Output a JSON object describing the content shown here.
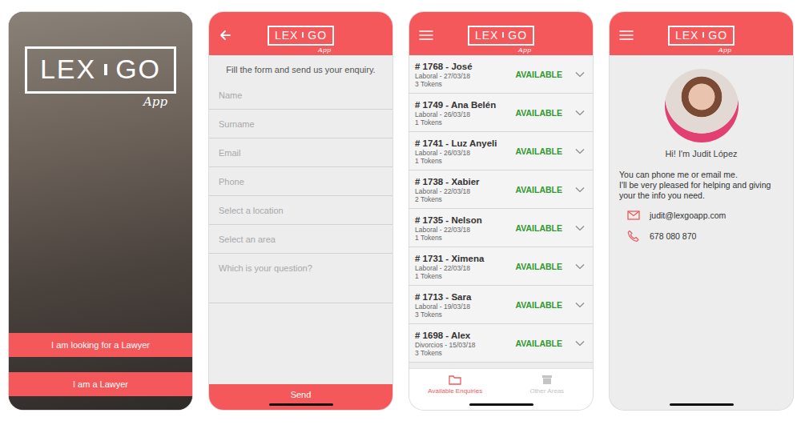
{
  "logo": {
    "left": "LEX",
    "right": "GO",
    "script": "App"
  },
  "welcome": {
    "buttons": [
      {
        "label": "I am looking for a Lawyer"
      },
      {
        "label": "I am a Lawyer"
      }
    ]
  },
  "enquiry_form": {
    "intro": "Fill the form and send us your enquiry.",
    "fields": [
      {
        "placeholder": "Name",
        "kind": "input"
      },
      {
        "placeholder": "Surname",
        "kind": "input"
      },
      {
        "placeholder": "Email",
        "kind": "input"
      },
      {
        "placeholder": "Phone",
        "kind": "input"
      },
      {
        "placeholder": "Select a location",
        "kind": "input"
      },
      {
        "placeholder": "Select an area",
        "kind": "input"
      },
      {
        "placeholder": "Which is your question?",
        "kind": "textarea"
      }
    ],
    "submit": "Send"
  },
  "enquiries": {
    "rows": [
      {
        "title": "# 1768 - José",
        "meta": "Laboral - 27/03/18",
        "tokens": "3 Tokens",
        "status": "AVAILABLE",
        "expanded": false
      },
      {
        "title": "# 1749 - Ana Belén",
        "meta": "Laboral - 26/03/18",
        "tokens": "1 Tokens",
        "status": "AVAILABLE",
        "expanded": false
      },
      {
        "title": "# 1741 - Luz Anyeli",
        "meta": "Laboral - 26/03/18",
        "tokens": "1 Tokens",
        "status": "AVAILABLE",
        "expanded": false
      },
      {
        "title": "# 1738 - Xabier",
        "meta": "Laboral - 22/03/18",
        "tokens": "2 Tokens",
        "status": "AVAILABLE",
        "expanded": false
      },
      {
        "title": "# 1735 - Nelson",
        "meta": "Laboral - 22/03/18",
        "tokens": "1 Tokens",
        "status": "AVAILABLE",
        "expanded": false
      },
      {
        "title": "# 1731 - Ximena",
        "meta": "Laboral - 22/03/18",
        "tokens": "1 Tokens",
        "status": "AVAILABLE",
        "expanded": false
      },
      {
        "title": "# 1713 - Sara",
        "meta": "Laboral - 19/03/18",
        "tokens": "3 Tokens",
        "status": "AVAILABLE",
        "expanded": false
      },
      {
        "title": "# 1698 - Alex",
        "meta": "Divorcios - 15/03/18",
        "tokens": "3 Tokens",
        "status": "AVAILABLE",
        "expanded": false
      }
    ],
    "tabs": [
      {
        "label": "Available Enquiries",
        "selected": true
      },
      {
        "label": "Other Areas",
        "selected": false
      }
    ]
  },
  "contact": {
    "greeting": "Hi! I'm Judit López",
    "message": [
      "You can phone me or email me.",
      "I'll be very pleased for helping and giving your the info you need."
    ],
    "email": "judit@lexgoapp.com",
    "phone": "678 080 870"
  }
}
